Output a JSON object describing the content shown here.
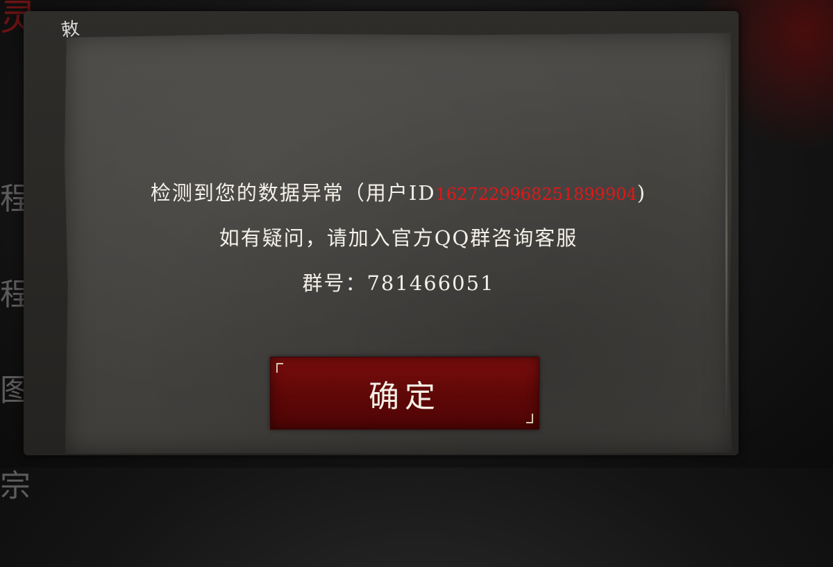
{
  "background": {
    "title_fragment": "灵",
    "side_menu": [
      "程",
      "程",
      "图",
      "宗"
    ],
    "stamp_text": "敕"
  },
  "dialog": {
    "line1_prefix": "检测到您的数据异常（用户ID",
    "user_id": "1627229968251899904",
    "line1_suffix": ")",
    "line2": "如有疑问，请加入官方QQ群咨询客服",
    "line3": "群号：781466051",
    "confirm_label": "确定"
  },
  "colors": {
    "accent_red": "#e01818",
    "button_red": "#6b0a0a",
    "text": "#f4f1ea"
  }
}
